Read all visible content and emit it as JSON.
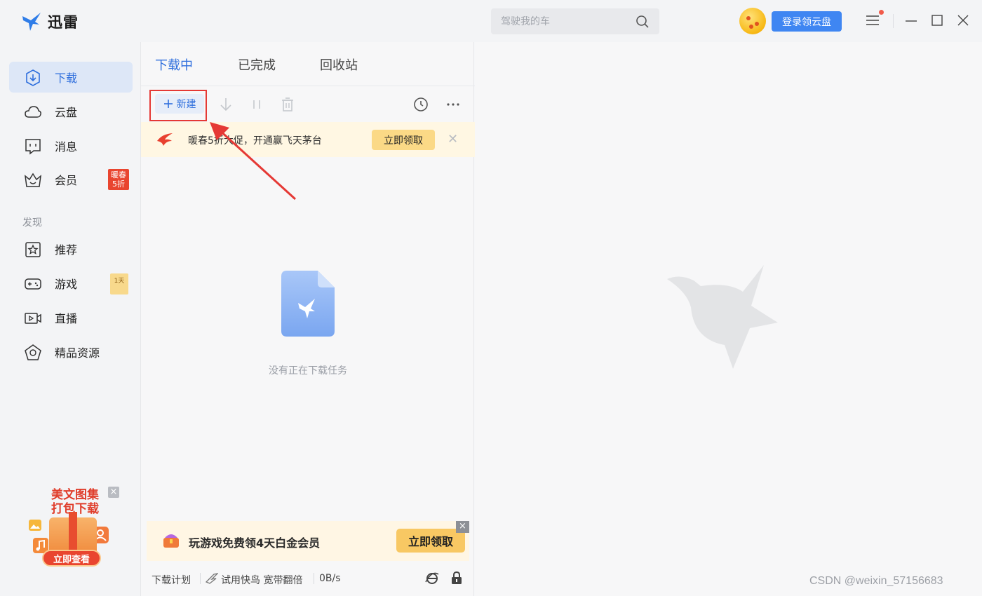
{
  "app": {
    "name": "迅雷",
    "search_placeholder": "驾驶我的车",
    "login_button": "登录领云盘"
  },
  "sidebar": {
    "items": [
      {
        "label": "下载",
        "icon": "download-icon",
        "active": true
      },
      {
        "label": "云盘",
        "icon": "cloud-icon",
        "active": false
      },
      {
        "label": "消息",
        "icon": "message-icon",
        "active": false
      },
      {
        "label": "会员",
        "icon": "crown-icon",
        "active": false,
        "badge": "暖春 5折"
      }
    ],
    "section_label": "发现",
    "discover": [
      {
        "label": "推荐",
        "icon": "star-icon"
      },
      {
        "label": "游戏",
        "icon": "gamepad-icon",
        "badge": "1天"
      },
      {
        "label": "直播",
        "icon": "live-icon"
      },
      {
        "label": "精品资源",
        "icon": "gem-icon"
      }
    ],
    "promo": {
      "title": "美文图集 打包下载",
      "button": "立即查看"
    }
  },
  "download_panel": {
    "tabs": [
      "下载中",
      "已完成",
      "回收站"
    ],
    "active_tab": "下载中",
    "new_button": "新建",
    "notice": {
      "text": "暖春5折大促，开通赢飞天茅台",
      "button": "立即领取"
    },
    "empty_text": "没有正在下载任务",
    "bottom_ad": {
      "text": "玩游戏免费领4天白金会员",
      "button": "立即领取"
    },
    "status": {
      "plan": "下载计划",
      "boost": "试用快鸟 宽带翻倍",
      "speed": "0B/s"
    }
  },
  "watermark": "CSDN @weixin_57156683",
  "colors": {
    "accent": "#2f6fdd",
    "login_button": "#3f86f2",
    "highlight_red": "#e53935",
    "notice_bg": "#fff7e3"
  }
}
